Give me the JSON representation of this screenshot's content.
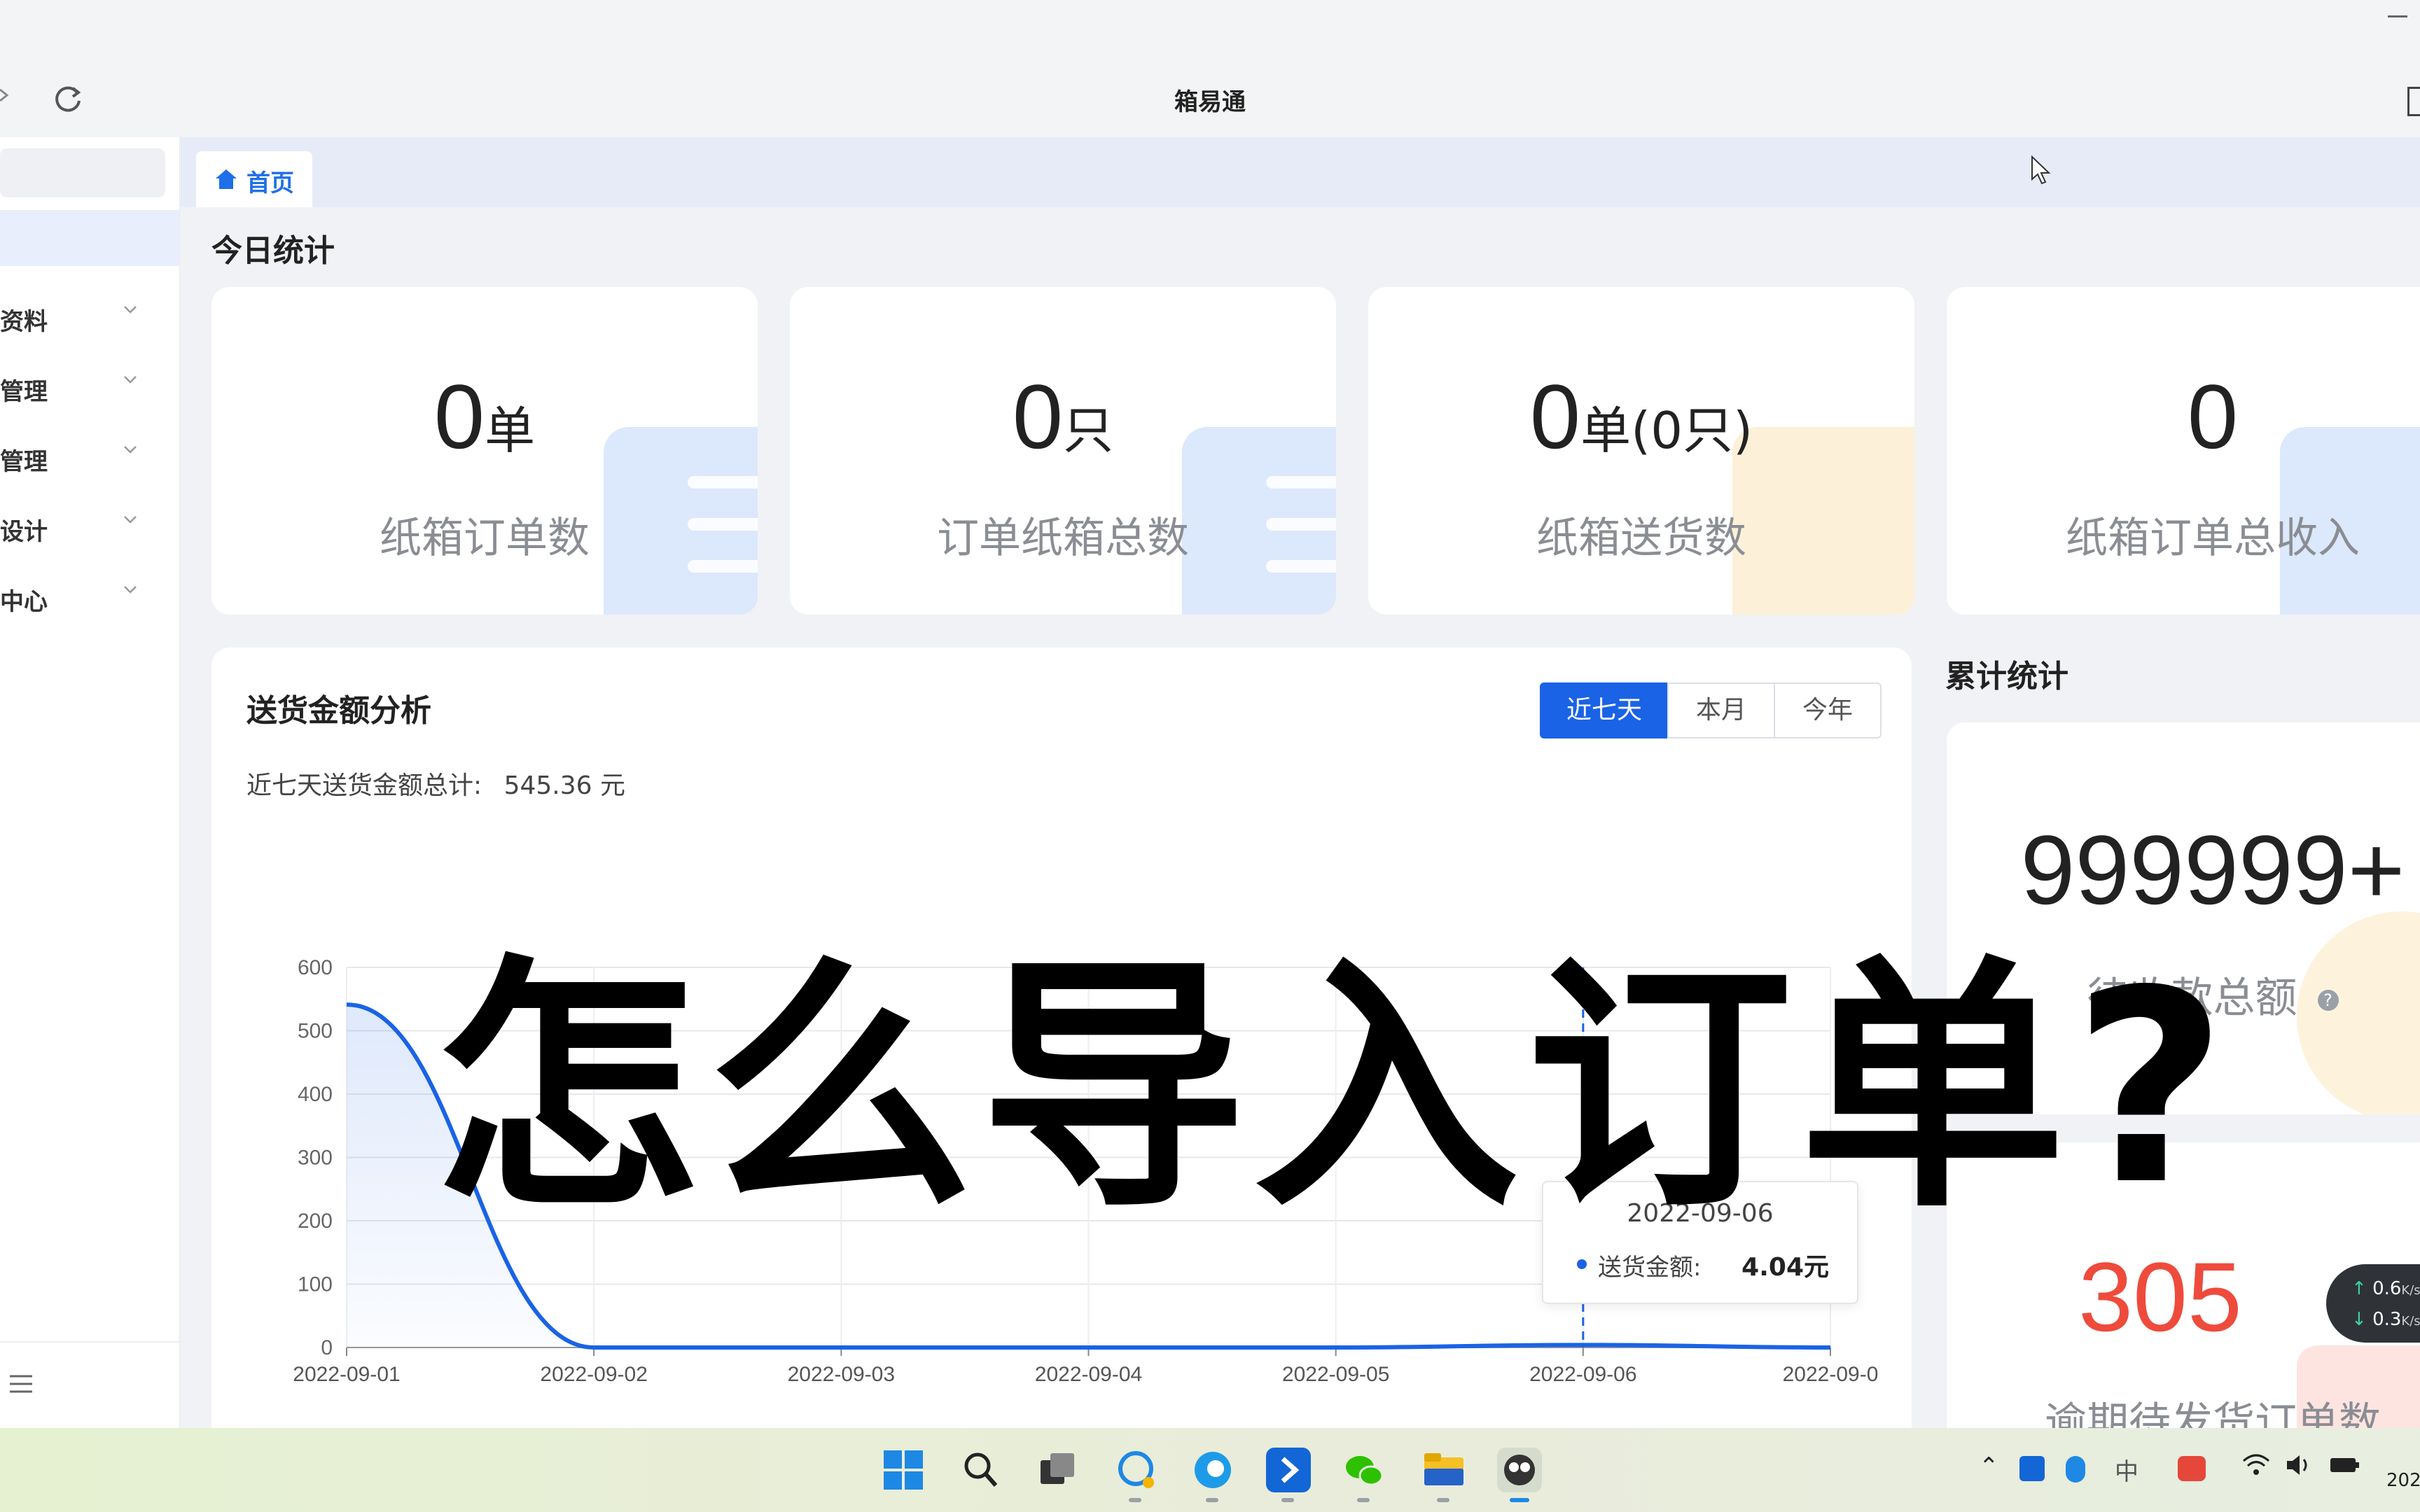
{
  "window": {
    "title": "箱易通"
  },
  "sidebar": {
    "items": [
      {
        "label": "资料"
      },
      {
        "label": "管理"
      },
      {
        "label": "管理"
      },
      {
        "label": "设计"
      },
      {
        "label": "中心"
      }
    ]
  },
  "tabs": [
    {
      "label": "首页"
    }
  ],
  "today": {
    "title": "今日统计",
    "cards": [
      {
        "value": "0",
        "unit": "单",
        "label": "纸箱订单数",
        "color": "#2b7de9"
      },
      {
        "value": "0",
        "unit": "只",
        "label": "订单纸箱总数",
        "color": "#2b7de9"
      },
      {
        "value": "0",
        "unit": "单(0只)",
        "label": "纸箱送货数",
        "color": "#f5a623"
      },
      {
        "value": "0",
        "unit": "",
        "label": "纸箱订单总收入",
        "color": "#2b7de9"
      }
    ]
  },
  "delivery": {
    "title": "送货金额分析",
    "summary_label": "近七天送货金额总计:",
    "summary_value": "545.36 元",
    "buttons": [
      "近七天",
      "本月",
      "今年"
    ],
    "active_button": "近七天",
    "tooltip": {
      "date": "2022-09-06",
      "series": "送货金额:",
      "value": "4.04元"
    }
  },
  "chart_data": {
    "type": "line",
    "x": [
      "2022-09-01",
      "2022-09-02",
      "2022-09-03",
      "2022-09-04",
      "2022-09-05",
      "2022-09-06",
      "2022-09-0"
    ],
    "series": [
      {
        "name": "送货金额",
        "values": [
          541.32,
          0,
          0,
          0,
          0,
          4.04,
          0
        ]
      }
    ],
    "ylim": [
      0,
      600
    ],
    "yticks": [
      "0",
      "100",
      "200",
      "300",
      "400",
      "500",
      "600"
    ],
    "grid": true,
    "color": "#1a63e6"
  },
  "cumulative": {
    "title": "累计统计",
    "cards": [
      {
        "value": "999999+",
        "label": "待收款总额"
      },
      {
        "value": "305",
        "label": "逾期待发货订单数",
        "color": "#ee4b3c"
      }
    ]
  },
  "overlay": {
    "text": "怎么导入订单?"
  },
  "network": {
    "up": "0.6",
    "down": "0.3",
    "unit": "K/s"
  },
  "taskbar": {
    "tray_ime": "中",
    "clock": "202"
  }
}
